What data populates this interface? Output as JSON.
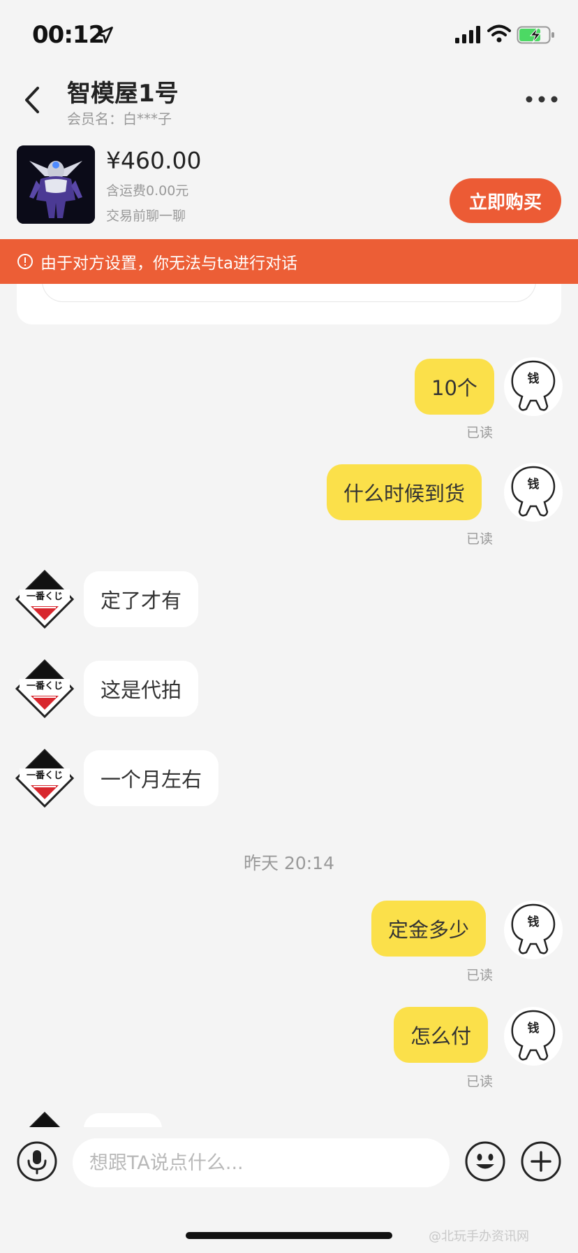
{
  "status_bar": {
    "time": "00:12"
  },
  "header": {
    "title": "智模屋1号",
    "member_name": "会员名：白***子"
  },
  "product": {
    "price": "¥460.00",
    "shipping": "含运费0.00元",
    "note": "交易前聊一聊",
    "buy_label": "立即购买",
    "thumb_icon": "action-figure-icon"
  },
  "warning": {
    "text": "由于对方设置，你无法与ta进行对话"
  },
  "messages": [
    {
      "from": "me",
      "text": "10个",
      "status": "已读"
    },
    {
      "from": "me",
      "text": "什么时候到货",
      "status": "已读"
    },
    {
      "from": "them",
      "text": "定了才有"
    },
    {
      "from": "them",
      "text": "这是代拍"
    },
    {
      "from": "them",
      "text": "一个月左右"
    },
    {
      "type": "timestamp",
      "text": "昨天 20:14"
    },
    {
      "from": "me",
      "text": "定金多少",
      "status": "已读"
    },
    {
      "from": "me",
      "text": "怎么付",
      "status": "已读"
    }
  ],
  "avatars": {
    "me_text": "钱",
    "them_logo": "ichiban-kuji-logo"
  },
  "input": {
    "placeholder": "想跟TA说点什么..."
  },
  "watermark": "@北玩手办资讯网",
  "colors": {
    "accent": "#ec5b35",
    "bubble_me": "#fbe04a",
    "background": "#f4f4f4"
  }
}
